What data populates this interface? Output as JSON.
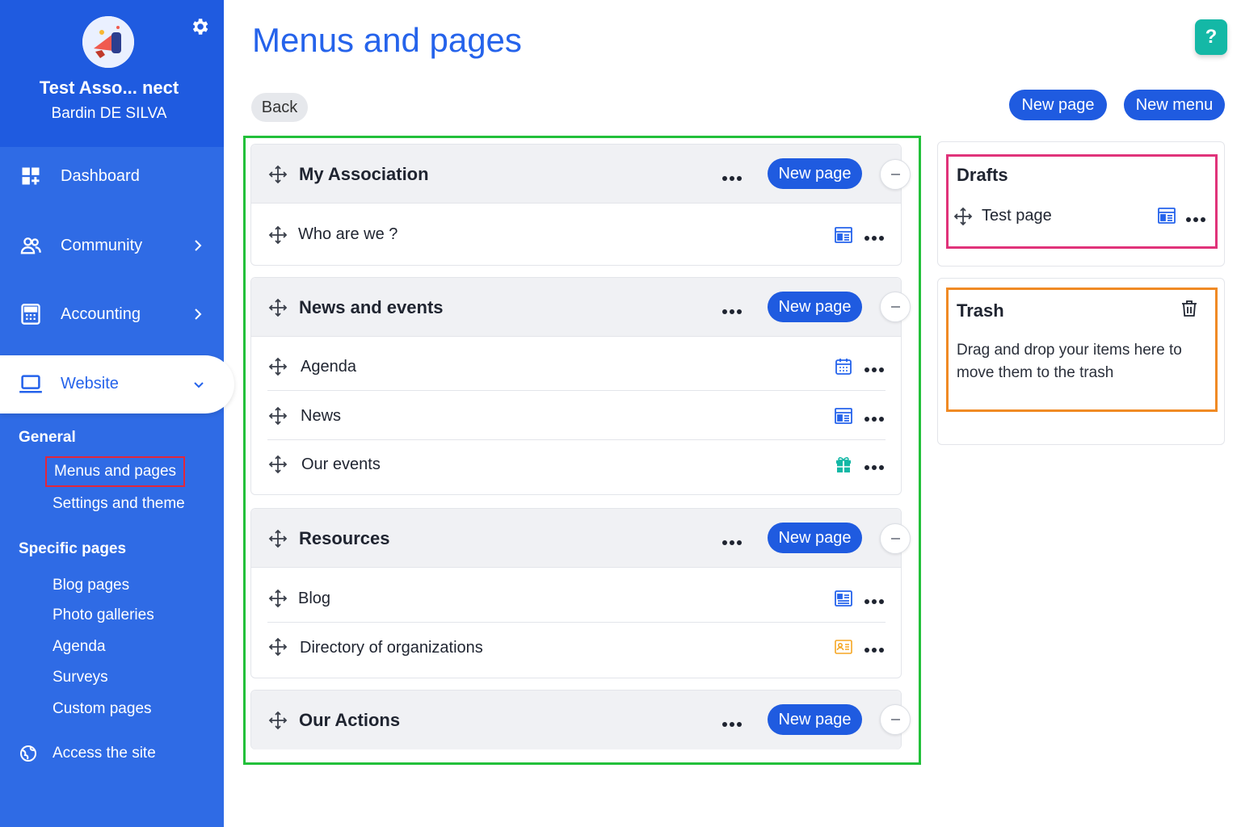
{
  "sidebar": {
    "org_name": "Test Asso... nect",
    "user_name": "Bardin DE SILVA",
    "nav": {
      "dashboard": "Dashboard",
      "community": "Community",
      "accounting": "Accounting",
      "website": "Website"
    },
    "general_title": "General",
    "general_links": [
      "Menus and pages",
      "Settings and theme"
    ],
    "specific_title": "Specific pages",
    "specific_links": [
      "Blog pages",
      "Photo galleries",
      "Agenda",
      "Surveys",
      "Custom pages"
    ],
    "access_label": "Access the site"
  },
  "header": {
    "title": "Menus and pages",
    "help": "?",
    "back": "Back",
    "new_page": "New page",
    "new_menu": "New menu"
  },
  "menus": [
    {
      "title": "My Association",
      "new_page": "New page",
      "items": [
        {
          "label": "Who are we ?",
          "icon": "page-icon"
        }
      ]
    },
    {
      "title": "News and events",
      "new_page": "New page",
      "items": [
        {
          "label": "Agenda",
          "icon": "calendar-icon"
        },
        {
          "label": "News",
          "icon": "page-icon"
        },
        {
          "label": "Our events",
          "icon": "gift-icon"
        }
      ]
    },
    {
      "title": "Resources",
      "new_page": "New page",
      "items": [
        {
          "label": "Blog",
          "icon": "blog-icon"
        },
        {
          "label": "Directory of organizations",
          "icon": "directory-icon"
        }
      ]
    },
    {
      "title": "Our Actions",
      "new_page": "New page",
      "items": []
    }
  ],
  "drafts": {
    "title": "Drafts",
    "items": [
      {
        "label": "Test page",
        "icon": "page-icon"
      }
    ]
  },
  "trash": {
    "title": "Trash",
    "text": "Drag and drop your items here to move them to the trash"
  },
  "colors": {
    "primary": "#1f5be0",
    "sidebar": "#2f6be5",
    "menus_zone_border": "#22c03a",
    "drafts_border": "#e0337a",
    "trash_border": "#f08a24",
    "current_link_border": "#e3263a",
    "help": "#14b8a6"
  }
}
